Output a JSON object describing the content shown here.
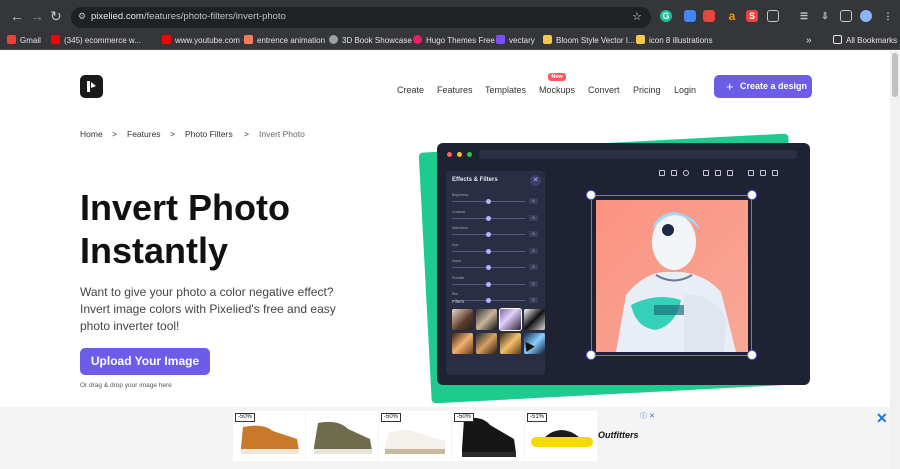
{
  "browser": {
    "url_host": "pixelied.com",
    "url_path": "/features/photo-filters/invert-photo",
    "bookmarks": [
      {
        "label": "Gmail",
        "color": "#ea4335"
      },
      {
        "label": "(345) ecommerce w...",
        "color": "#ff0000"
      },
      {
        "label": "www.youtube.com",
        "color": "#ff0000"
      },
      {
        "label": "entrence animation",
        "color": "#ff7a59"
      },
      {
        "label": "3D Book Showcase",
        "color": "#9aa0a6"
      },
      {
        "label": "Hugo Themes Free",
        "color": "#e91e63"
      },
      {
        "label": "vectary",
        "color": "#7c4dff"
      },
      {
        "label": "Bloom Style Vector I...",
        "color": "#f2c94c"
      },
      {
        "label": "icon 8 illustrations",
        "color": "#f2c94c"
      }
    ],
    "more_bookmarks": "»",
    "all_bookmarks": "All Bookmarks"
  },
  "nav": {
    "links": [
      "Create",
      "Features",
      "Templates",
      "Mockups",
      "Convert",
      "Pricing",
      "Login"
    ],
    "new_badge": "New",
    "cta": "Create a design"
  },
  "breadcrumb": {
    "items": [
      "Home",
      "Features",
      "Photo Filters",
      "Invert Photo"
    ],
    "separator": ">"
  },
  "hero": {
    "title_line1": "Invert Photo",
    "title_line2": "Instantly",
    "subtitle": "Want to give your photo a color negative effect? Invert image colors with Pixelied's free and easy photo inverter tool!",
    "upload_button": "Upload Your Image",
    "drag_hint": "Or drag & drop your image here"
  },
  "editor": {
    "panel_title": "Effects & Filters",
    "sliders": [
      {
        "label": "Brightness",
        "value": 0.5,
        "display": "0"
      },
      {
        "label": "Contrast",
        "value": 0.5,
        "display": "0"
      },
      {
        "label": "Saturation",
        "value": 0.5,
        "display": "0"
      },
      {
        "label": "Hue",
        "value": 0.5,
        "display": "0"
      },
      {
        "label": "Noise",
        "value": 0.5,
        "display": "0"
      },
      {
        "label": "Pixelate",
        "value": 0.5,
        "display": "0"
      },
      {
        "label": "Blur",
        "value": 0.5,
        "display": "0"
      }
    ],
    "filters_label": "Filters"
  },
  "ad": {
    "discounts": [
      "-50%",
      "",
      "-50%",
      "-50%",
      "-51%"
    ],
    "brand": "Outfitters",
    "info": "ⓘ ✕",
    "close": "✕"
  },
  "colors": {
    "accent": "#6c5ce7",
    "green_card": "#1ecb8f",
    "editor_bg": "#1f2233"
  }
}
